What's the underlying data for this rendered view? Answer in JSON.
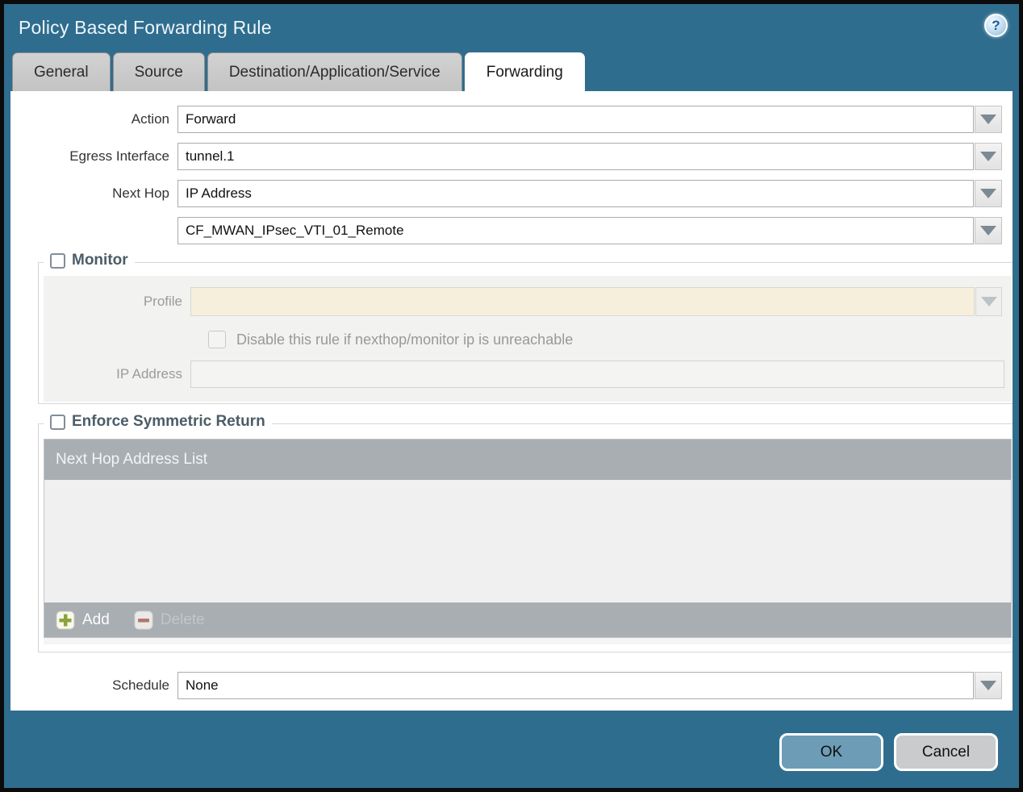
{
  "dialog": {
    "title": "Policy Based Forwarding Rule",
    "help_icon_glyph": "?",
    "tabs": [
      {
        "label": "General",
        "active": false
      },
      {
        "label": "Source",
        "active": false
      },
      {
        "label": "Destination/Application/Service",
        "active": false
      },
      {
        "label": "Forwarding",
        "active": true
      }
    ]
  },
  "form": {
    "action": {
      "label": "Action",
      "value": "Forward"
    },
    "egress_interface": {
      "label": "Egress Interface",
      "value": "tunnel.1"
    },
    "next_hop": {
      "label": "Next Hop",
      "value": "IP Address"
    },
    "next_hop_address": {
      "value": "CF_MWAN_IPsec_VTI_01_Remote"
    },
    "schedule": {
      "label": "Schedule",
      "value": "None"
    }
  },
  "monitor": {
    "legend": "Monitor",
    "checked": false,
    "profile": {
      "label": "Profile",
      "value": ""
    },
    "disable_rule": {
      "label": "Disable this rule if nexthop/monitor ip is unreachable",
      "checked": false
    },
    "ip_address": {
      "label": "IP Address",
      "value": ""
    }
  },
  "symmetric_return": {
    "legend": "Enforce Symmetric Return",
    "checked": false,
    "table": {
      "header": "Next Hop Address List",
      "rows": []
    },
    "add_label": "Add",
    "delete_label": "Delete",
    "delete_enabled": false
  },
  "footer": {
    "ok_label": "OK",
    "cancel_label": "Cancel"
  },
  "colors": {
    "titlebar_teal": "#2f6d8e",
    "active_tab": "#ffffff",
    "inactive_tab": "#c8c8c8",
    "legend_text": "#4c5c68",
    "disabled_field_beige": "#f6efdb",
    "table_gray": "#a9aeb2",
    "ok_button": "#6d9cb6",
    "cancel_button": "#c9cbcc",
    "add_plus_green": "#8ba33c",
    "delete_minus_red": "#b5776b"
  }
}
